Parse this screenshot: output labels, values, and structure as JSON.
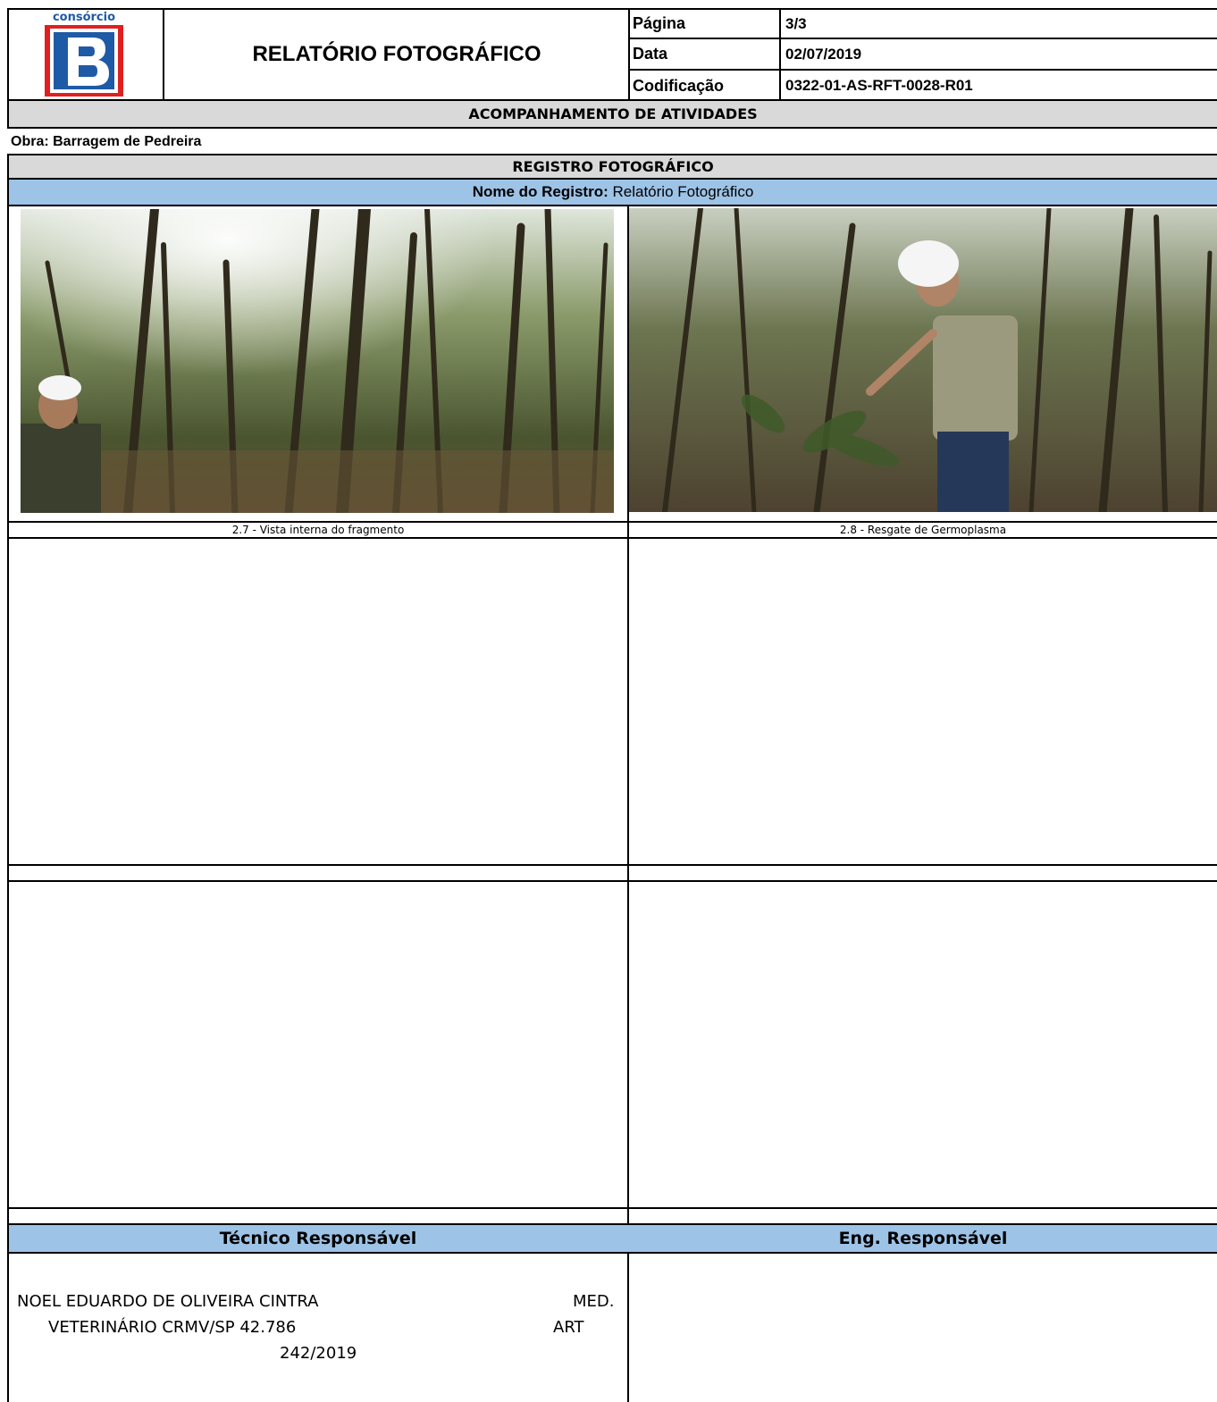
{
  "header": {
    "logo_caption": "consórcio",
    "logo_letter": "B",
    "title": "RELATÓRIO FOTOGRÁFICO",
    "meta": [
      {
        "label": "Página",
        "value": "3/3"
      },
      {
        "label": "Data",
        "value": "02/07/2019"
      },
      {
        "label": "Codificação",
        "value": "0322-01-AS-RFT-0028-R01"
      }
    ]
  },
  "section_title": "ACOMPANHAMENTO DE ATIVIDADES",
  "obra": "Obra: Barragem de Pedreira",
  "registro_title": "REGISTRO FOTOGRÁFICO",
  "registro_name": {
    "label": "Nome do Registro:",
    "value": "Relatório Fotográfico"
  },
  "photos": [
    {
      "caption": "2.7 - Vista interna do fragmento"
    },
    {
      "caption": "2.8 - Resgate de Germoplasma"
    }
  ],
  "responsible": {
    "tecnico_label": "Técnico Responsável",
    "eng_label": "Eng. Responsável",
    "tecnico_lines": [
      "NOEL EDUARDO DE OLIVEIRA CINTRA",
      "MED.",
      "VETERINÁRIO CRMV/SP 42.786",
      "ART",
      "242/2019"
    ]
  },
  "colors": {
    "header_blue": "#9dc3e6",
    "band_gray": "#d9d9d9",
    "logo_blue": "#1f5aa6",
    "logo_red": "#e02020"
  }
}
